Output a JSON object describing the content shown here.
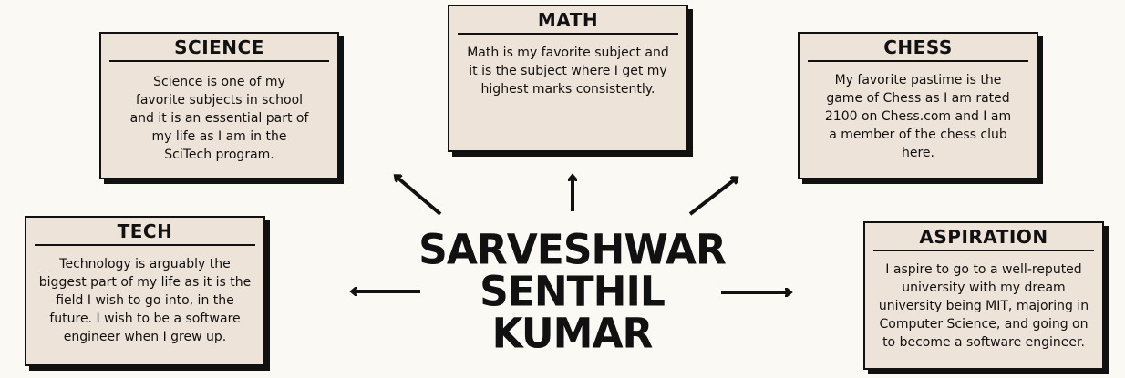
{
  "central_name": [
    "SARVESHWAR",
    "SENTHIL",
    "KUMAR"
  ],
  "cards": {
    "science": {
      "title": "SCIENCE",
      "body": "Science is one of my favorite subjects in school and it is an essential part of my life as I am in the SciTech program."
    },
    "math": {
      "title": "MATH",
      "body": "Math is my favorite subject and it is the subject where I get my highest marks consistently."
    },
    "chess": {
      "title": "CHESS",
      "body": "My favorite pastime is the game of Chess as I am rated 2100 on Chess.com and I am a member of the chess club here."
    },
    "tech": {
      "title": "TECH",
      "body": "Technology is arguably the biggest part of my life as it is the field I wish to go into, in the future. I wish to be a software engineer when I grew up."
    },
    "aspiration": {
      "title": "ASPIRATION",
      "body": "I aspire to go to a well-reputed university with my dream university being MIT, majoring in Computer Science, and going on to become a software engineer."
    }
  },
  "colors": {
    "background": "#fbf9f4",
    "card_fill": "#eee3d8",
    "ink": "#111111"
  }
}
